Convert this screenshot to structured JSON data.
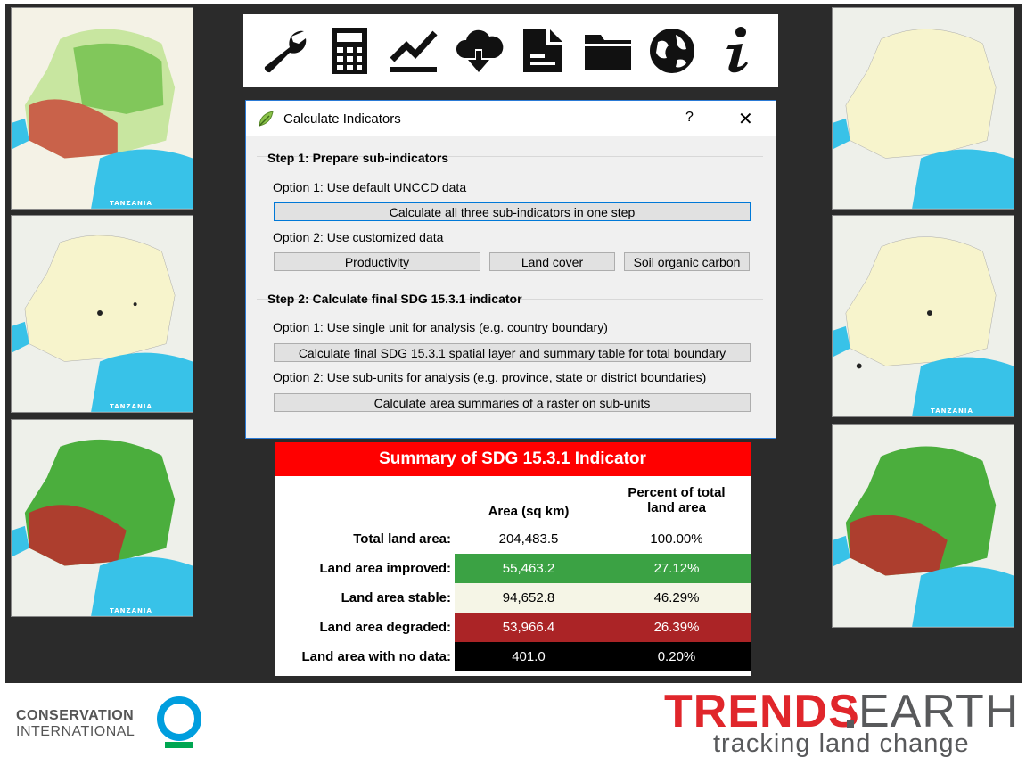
{
  "dialog": {
    "title": "Calculate Indicators",
    "help": "?",
    "close": "✕",
    "step1": {
      "title": "Step 1: Prepare sub-indicators",
      "option1": "Option 1: Use default UNCCD data",
      "all_button": "Calculate all three sub-indicators in one step",
      "option2": "Option 2: Use customized data",
      "productivity_button": "Productivity",
      "landcover_button": "Land cover",
      "soc_button": "Soil organic carbon"
    },
    "step2": {
      "title": "Step 2: Calculate final SDG 15.3.1 indicator",
      "option1": "Option 1: Use single unit for analysis (e.g. country boundary)",
      "final_button": "Calculate final SDG 15.3.1 spatial layer and summary table for total boundary",
      "option2": "Option 2: Use sub-units for analysis (e.g. province, state or district boundaries)",
      "subunit_button": "Calculate area summaries of a raster on sub-units"
    }
  },
  "toolbar": {
    "icons": [
      "wrench-icon",
      "calculator-icon",
      "chart-line-icon",
      "cloud-download-icon",
      "report-icon",
      "folder-icon",
      "globe-icon",
      "info-icon"
    ]
  },
  "summary": {
    "title": "Summary of SDG 15.3.1 Indicator",
    "col_area": "Area (sq km)",
    "col_percent": "Percent of total land area",
    "rows": [
      {
        "label": "Total land area:",
        "area": "204,483.5",
        "percent": "100.00%",
        "color": "#ffffff",
        "text": "#000000"
      },
      {
        "label": "Land area improved:",
        "area": "55,463.2",
        "percent": "27.12%",
        "color": "#3ba244",
        "text": "#ffffff"
      },
      {
        "label": "Land area stable:",
        "area": "94,652.8",
        "percent": "46.29%",
        "color": "#f5f5e6",
        "text": "#000000"
      },
      {
        "label": "Land area degraded:",
        "area": "53,966.4",
        "percent": "26.39%",
        "color": "#ab2426",
        "text": "#ffffff"
      },
      {
        "label": "Land area with no data:",
        "area": "401.0",
        "percent": "0.20%",
        "color": "#000000",
        "text": "#ffffff"
      }
    ]
  },
  "maps": {
    "label": "TANZANIA"
  },
  "logos": {
    "ci_line1": "CONSERVATION",
    "ci_line2": "INTERNATIONAL",
    "te_trends": "TRENDS",
    "te_earth": "EARTH",
    "te_tagline": "tracking land change"
  },
  "colors": {
    "accent": "#e0262b",
    "ci_ring": "#009ede",
    "ci_bar": "#00a651"
  }
}
